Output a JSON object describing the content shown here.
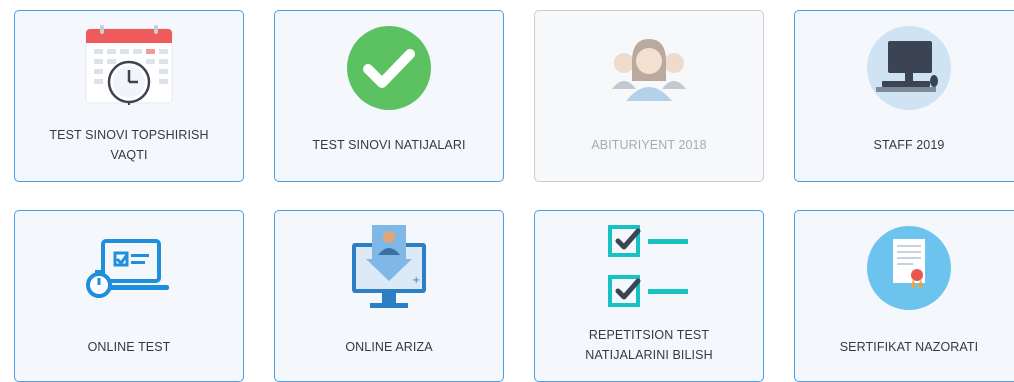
{
  "cards": [
    {
      "label_line1": "TEST SINOVI TOPSHIRISH",
      "label_line2": "VAQTI",
      "icon": "calendar-clock-icon"
    },
    {
      "label_line1": "TEST SINOVI NATIJALARI",
      "label_line2": "",
      "icon": "checkmark-icon"
    },
    {
      "label_line1": "ABITURIYENT 2018",
      "label_line2": "",
      "icon": "people-group-icon",
      "disabled": true
    },
    {
      "label_line1": "STAFF 2019",
      "label_line2": "",
      "icon": "computer-desk-icon"
    },
    {
      "label_line1": "ONLINE TEST",
      "label_line2": "",
      "icon": "laptop-test-icon"
    },
    {
      "label_line1": "ONLINE ARIZA",
      "label_line2": "",
      "icon": "application-monitor-icon"
    },
    {
      "label_line1": "REPETITSION TEST",
      "label_line2": "NATIJALARINI BILISH",
      "icon": "checklist-icon"
    },
    {
      "label_line1": "SERTIFIKAT NAZORATI",
      "label_line2": "",
      "icon": "certificate-icon"
    }
  ],
  "colors": {
    "border": "#4a9ee8",
    "card_bg": "#f4f8fd",
    "disabled_border": "#c9ccd1",
    "disabled_text": "#a6abb2",
    "accent_green": "#5cc160",
    "accent_teal": "#19c2c2",
    "accent_blue": "#1f8fdc"
  }
}
